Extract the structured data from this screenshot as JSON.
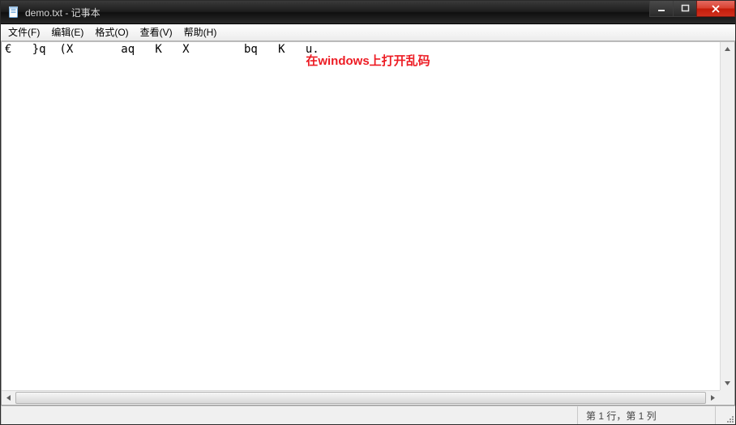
{
  "window": {
    "title": "demo.txt - 记事本"
  },
  "menu": {
    "items": [
      {
        "label": "文件(F)"
      },
      {
        "label": "编辑(E)"
      },
      {
        "label": "格式(O)"
      },
      {
        "label": "查看(V)"
      },
      {
        "label": "帮助(H)"
      }
    ]
  },
  "content": {
    "text": "€   }q  (X       aq   K   X        bq   K   u.",
    "annotation": "在windows上打开乱码"
  },
  "status": {
    "position": "第 1 行，第 1 列"
  }
}
